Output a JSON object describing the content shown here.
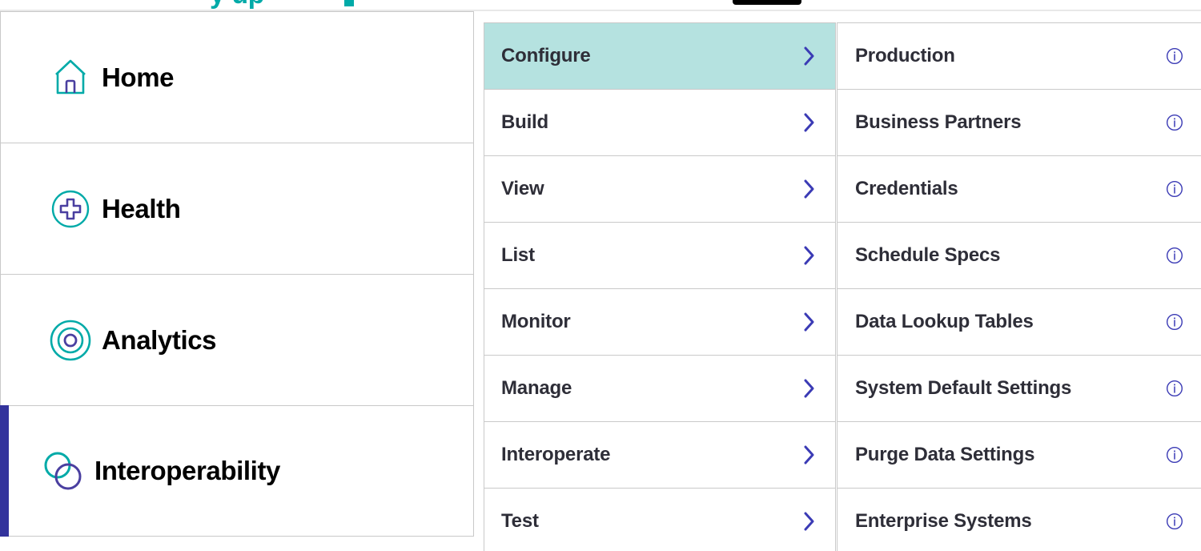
{
  "colors": {
    "teal": "#00aaa8",
    "purple": "#3b3bb5",
    "indigo_accent": "#33339c",
    "highlight_mint": "#b5e2e0",
    "border_gray": "#c9c9c9",
    "label_dark": "#2e2e38"
  },
  "top_strip": {
    "logo_fragment": "y up",
    "pill_fragment": ""
  },
  "rail": {
    "items": [
      {
        "label": "Home",
        "icon": "home-icon",
        "active": false
      },
      {
        "label": "Health",
        "icon": "health-cross-icon",
        "active": false
      },
      {
        "label": "Analytics",
        "icon": "analytics-target-icon",
        "active": false
      },
      {
        "label": "Interoperability",
        "icon": "interop-rings-icon",
        "active": true
      }
    ]
  },
  "submenu": {
    "items": [
      {
        "label": "Configure",
        "icon": "chevron-right-icon",
        "selected": true
      },
      {
        "label": "Build",
        "icon": "chevron-right-icon",
        "selected": false
      },
      {
        "label": "View",
        "icon": "chevron-right-icon",
        "selected": false
      },
      {
        "label": "List",
        "icon": "chevron-right-icon",
        "selected": false
      },
      {
        "label": "Monitor",
        "icon": "chevron-right-icon",
        "selected": false
      },
      {
        "label": "Manage",
        "icon": "chevron-right-icon",
        "selected": false
      },
      {
        "label": "Interoperate",
        "icon": "chevron-right-icon",
        "selected": false
      },
      {
        "label": "Test",
        "icon": "chevron-right-icon",
        "selected": false
      }
    ]
  },
  "detail_menu": {
    "items": [
      {
        "label": "Production",
        "icon": "info-icon"
      },
      {
        "label": "Business Partners",
        "icon": "info-icon"
      },
      {
        "label": "Credentials",
        "icon": "info-icon"
      },
      {
        "label": "Schedule Specs",
        "icon": "info-icon"
      },
      {
        "label": "Data Lookup Tables",
        "icon": "info-icon"
      },
      {
        "label": "System Default Settings",
        "icon": "info-icon"
      },
      {
        "label": "Purge Data Settings",
        "icon": "info-icon"
      },
      {
        "label": "Enterprise Systems",
        "icon": "info-icon"
      }
    ]
  }
}
